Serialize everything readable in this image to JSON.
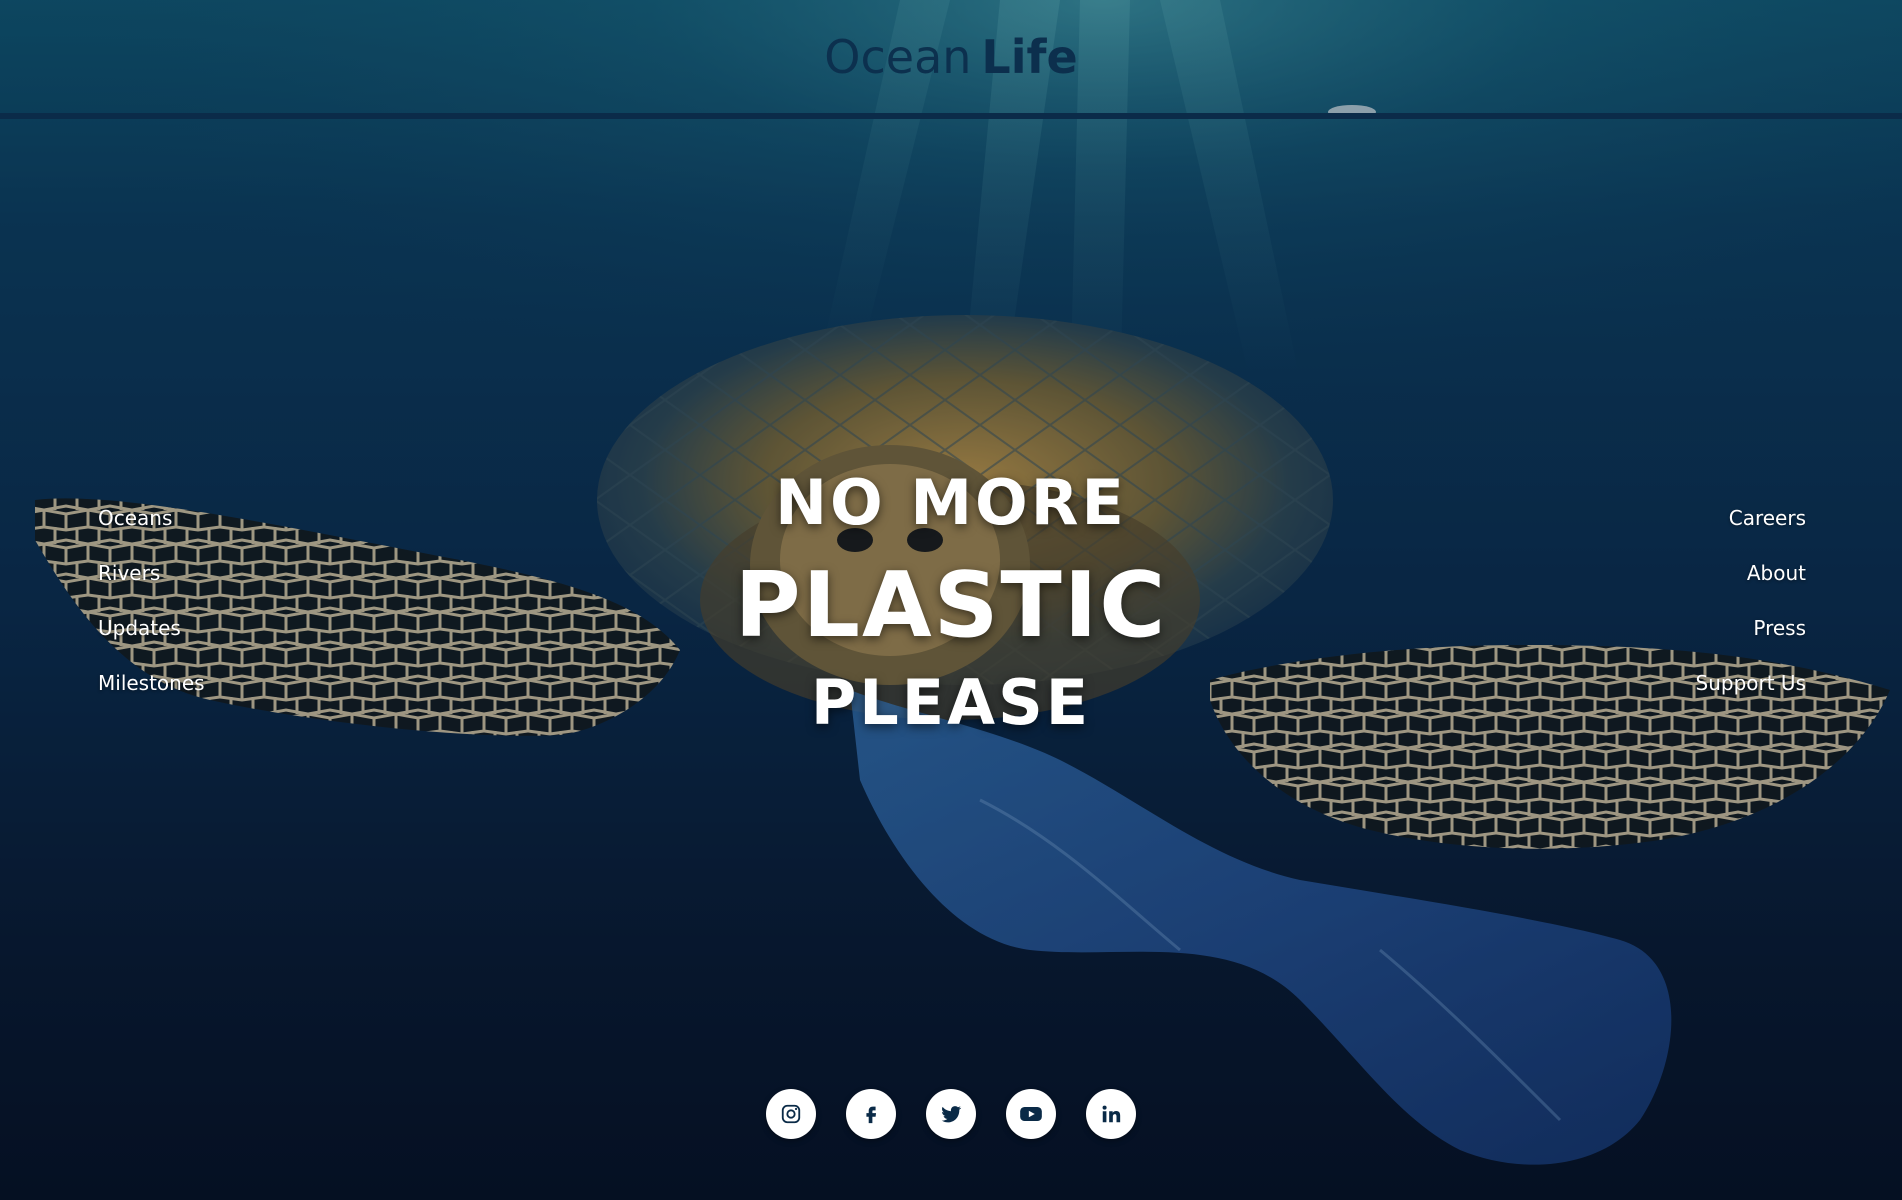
{
  "brand": {
    "light": "Ocean",
    "bold": "Life"
  },
  "nav_left": [
    "Oceans",
    "Rivers",
    "Updates",
    "Milestones"
  ],
  "nav_right": [
    "Careers",
    "About",
    "Press",
    "Support Us"
  ],
  "hero": {
    "line1": "NO MORE",
    "line2": "PLASTIC",
    "line3": "PLEASE"
  },
  "social": [
    {
      "icon": "instagram-icon"
    },
    {
      "icon": "facebook-icon"
    },
    {
      "icon": "twitter-icon"
    },
    {
      "icon": "youtube-icon"
    },
    {
      "icon": "linkedin-icon"
    }
  ],
  "colors": {
    "background_top": "#0e4f6e",
    "background_bottom": "#061327",
    "brand": "#0c2f4d",
    "text": "#ffffff",
    "social_icon": "#0a2a47"
  }
}
